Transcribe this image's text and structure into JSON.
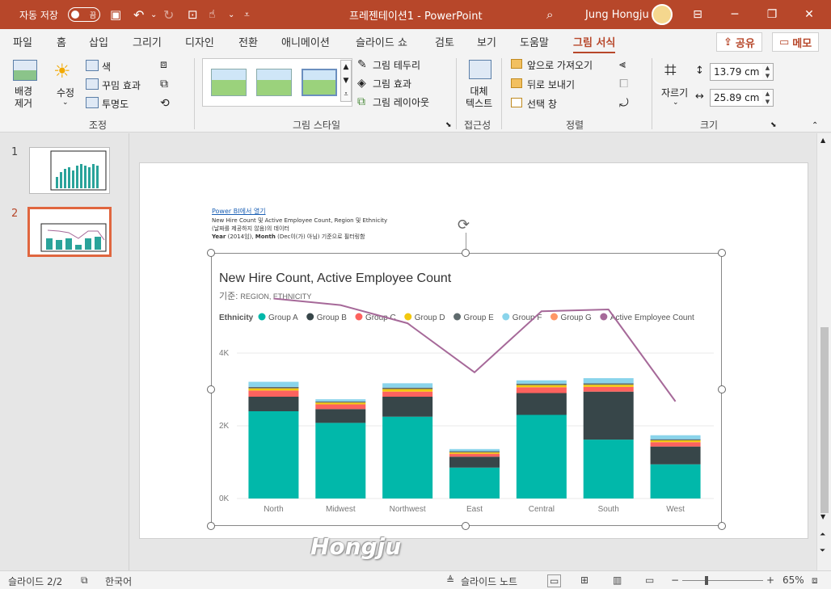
{
  "titlebar": {
    "autosave_label": "자동 저장",
    "autosave_state": "끔",
    "document_title": "프레젠테이션1  -  PowerPoint",
    "user_name": "Jung Hongju"
  },
  "tabs": [
    "파일",
    "홈",
    "삽입",
    "그리기",
    "디자인",
    "전환",
    "애니메이션",
    "슬라이드 쇼",
    "검토",
    "보기",
    "도움말",
    "그림 서식"
  ],
  "share_label": "공유",
  "comments_label": "메모",
  "ribbon": {
    "remove_bg": "배경\n제거",
    "corrections": "수정",
    "color": "색",
    "artistic": "꾸밈 효과",
    "transparency": "투명도",
    "adjust_group": "조정",
    "border": "그림 테두리",
    "effects": "그림 효과",
    "layout": "그림 레이아웃",
    "styles_group": "그림 스타일",
    "alt_text": "대체\n텍스트",
    "access_group": "접근성",
    "bring_forward": "앞으로 가져오기",
    "send_backward": "뒤로 보내기",
    "selection_pane": "선택 창",
    "arrange_group": "정렬",
    "crop": "자르기",
    "height": "13.79 cm",
    "width": "25.89 cm",
    "size_group": "크기"
  },
  "thumbnails": [
    {
      "num": "1",
      "active": false
    },
    {
      "num": "2",
      "active": true
    }
  ],
  "slide": {
    "pbi_link": "Power BI에서 열기",
    "meta1": "New Hire Count 및 Active Employee Count, Region 및 Ethnicity",
    "meta2": "(날짜를 제공하지 않음)의 데이터",
    "meta3_bold1": "Year",
    "meta3_a": " (2014임), ",
    "meta3_bold2": "Month",
    "meta3_b": " (Dec이(가) 아님) 기준으로 필터링함"
  },
  "chart_data": {
    "type": "bar",
    "title": "New Hire Count, Active Employee Count",
    "subtitle_prefix": "기준:",
    "subtitle": "REGION, ETHNICITY",
    "legend_title": "Ethnicity",
    "categories": [
      "North",
      "Midwest",
      "Northwest",
      "East",
      "Central",
      "South",
      "West"
    ],
    "yticks": [
      "0K",
      "2K",
      "4K"
    ],
    "ylim": [
      0,
      6000
    ],
    "stacked": true,
    "series": [
      {
        "name": "Group A",
        "color": "#01b8aa",
        "values": [
          2400,
          2080,
          2250,
          850,
          2300,
          1620,
          940
        ]
      },
      {
        "name": "Group B",
        "color": "#374649",
        "values": [
          400,
          380,
          550,
          300,
          600,
          1320,
          490
        ]
      },
      {
        "name": "Group C",
        "color": "#fd625e",
        "values": [
          170,
          130,
          140,
          80,
          160,
          130,
          120
        ]
      },
      {
        "name": "Group D",
        "color": "#f2c80f",
        "values": [
          60,
          50,
          70,
          40,
          60,
          60,
          50
        ]
      },
      {
        "name": "Group E",
        "color": "#5f6b6d",
        "values": [
          40,
          30,
          40,
          30,
          40,
          40,
          30
        ]
      },
      {
        "name": "Group F",
        "color": "#8ad4eb",
        "values": [
          140,
          60,
          120,
          60,
          90,
          140,
          110
        ]
      },
      {
        "name": "Group G",
        "color": "#fe9666",
        "values": [
          0,
          0,
          0,
          0,
          0,
          0,
          0
        ]
      }
    ],
    "line": {
      "name": "Active Employee Count",
      "color": "#a66999",
      "values": [
        5500,
        5320,
        4820,
        3470,
        5150,
        5200,
        2670
      ]
    },
    "grid": true,
    "legend_position": "top-left"
  },
  "watermark": "Hongju",
  "statusbar": {
    "slide_info": "슬라이드 2/2",
    "language": "한국어",
    "notes": "슬라이드 노트",
    "zoom": "65%"
  }
}
